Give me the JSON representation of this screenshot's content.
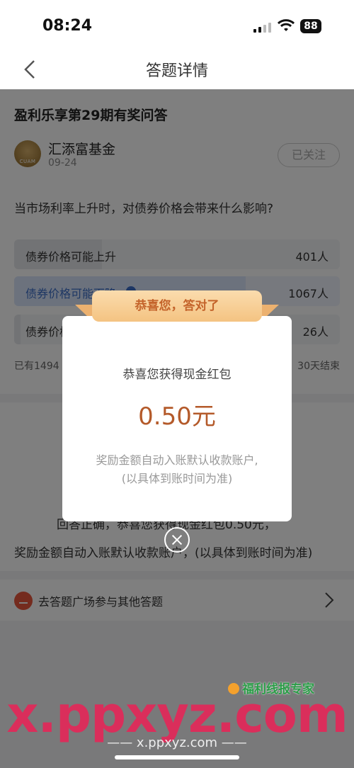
{
  "status_bar": {
    "time": "08:24",
    "battery": "88"
  },
  "nav": {
    "title": "答题详情"
  },
  "post": {
    "title": "盈利乐享第29期有奖问答",
    "author": "汇添富基金",
    "author_logo_text": "CUAM",
    "date": "09-24",
    "follow_label": "已关注",
    "question": "当市场利率上升时，对债券价格会带来什么影响?",
    "options": [
      {
        "label": "债券价格可能上升",
        "count": "401人",
        "share": 0.27
      },
      {
        "label": "债券价格可能下降",
        "count": "1067人",
        "share": 0.71,
        "selected": true
      },
      {
        "label": "债券价格",
        "count": "26人",
        "share": 0.02
      }
    ],
    "footer_left": "已有1494",
    "footer_right": "30天结束"
  },
  "result": {
    "line1": "回答正确，恭喜您获得现金红包0.50元，",
    "line2": "奖励金额自动入账默认收款账户，(以具体到账时间为准)"
  },
  "link": {
    "text": "去答题广场参与其他答题"
  },
  "modal": {
    "ribbon": "恭喜您，答对了",
    "subtitle": "恭喜您获得现金红包",
    "amount": "0.50元",
    "note1": "奖励金额自动入账默认收款账户,",
    "note2": "(以具体到账时间为准)"
  },
  "watermark": {
    "badge": "福利线报专家",
    "big": "x.ppxyz.com",
    "small": "—— x.ppxyz.com ——"
  },
  "colors": {
    "accent_blue": "#3d6fc9",
    "ribbon_text": "#c4632a",
    "amount": "#b45a2a",
    "watermark": "#e02b5a"
  },
  "icons": [
    "signal-icon",
    "wifi-icon",
    "battery-icon",
    "back-arrow-icon",
    "check-icon",
    "edit-icon",
    "chevron-right-icon",
    "close-icon"
  ]
}
